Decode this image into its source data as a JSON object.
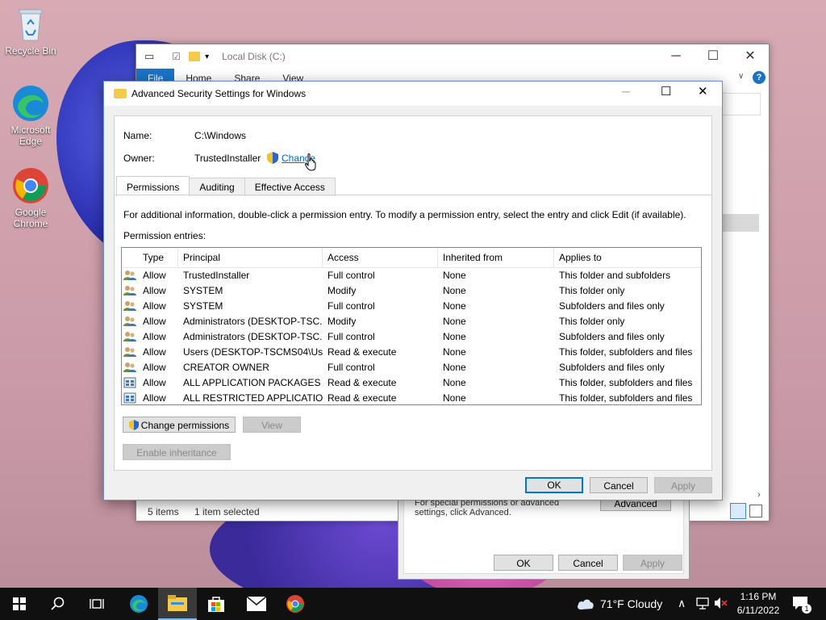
{
  "desktop": {
    "icons": [
      {
        "label": "Recycle Bin"
      },
      {
        "label": "Microsoft Edge"
      },
      {
        "label": "Google Chrome"
      }
    ]
  },
  "explorer": {
    "title": "Local Disk (C:)",
    "ribbon_tabs": [
      "File",
      "Home",
      "Share",
      "View"
    ],
    "status_items": "5 items",
    "status_selected": "1 item selected"
  },
  "properties_dialog": {
    "text": "For special permissions or advanced settings, click Advanced.",
    "advanced_label": "Advanced",
    "ok_label": "OK",
    "cancel_label": "Cancel",
    "apply_label": "Apply"
  },
  "dialog": {
    "title": "Advanced Security Settings for Windows",
    "name_label": "Name:",
    "name_value": "C:\\Windows",
    "owner_label": "Owner:",
    "owner_value": "TrustedInstaller",
    "change_link": "Change",
    "tabs": [
      "Permissions",
      "Auditing",
      "Effective Access"
    ],
    "info_text": "For additional information, double-click a permission entry. To modify a permission entry, select the entry and click Edit (if available).",
    "entries_label": "Permission entries:",
    "columns": [
      "Type",
      "Principal",
      "Access",
      "Inherited from",
      "Applies to"
    ],
    "rows": [
      {
        "type": "Allow",
        "principal": "TrustedInstaller",
        "access": "Full control",
        "inherited": "None",
        "applies": "This folder and subfolders",
        "icon": "user-group-icon"
      },
      {
        "type": "Allow",
        "principal": "SYSTEM",
        "access": "Modify",
        "inherited": "None",
        "applies": "This folder only",
        "icon": "user-group-icon"
      },
      {
        "type": "Allow",
        "principal": "SYSTEM",
        "access": "Full control",
        "inherited": "None",
        "applies": "Subfolders and files only",
        "icon": "user-group-icon"
      },
      {
        "type": "Allow",
        "principal": "Administrators (DESKTOP-TSC...",
        "access": "Modify",
        "inherited": "None",
        "applies": "This folder only",
        "icon": "user-group-icon"
      },
      {
        "type": "Allow",
        "principal": "Administrators (DESKTOP-TSC...",
        "access": "Full control",
        "inherited": "None",
        "applies": "Subfolders and files only",
        "icon": "user-group-icon"
      },
      {
        "type": "Allow",
        "principal": "Users (DESKTOP-TSCMS04\\Us...",
        "access": "Read & execute",
        "inherited": "None",
        "applies": "This folder, subfolders and files",
        "icon": "user-group-icon"
      },
      {
        "type": "Allow",
        "principal": "CREATOR OWNER",
        "access": "Full control",
        "inherited": "None",
        "applies": "Subfolders and files only",
        "icon": "user-group-icon"
      },
      {
        "type": "Allow",
        "principal": "ALL APPLICATION PACKAGES",
        "access": "Read & execute",
        "inherited": "None",
        "applies": "This folder, subfolders and files",
        "icon": "package-icon"
      },
      {
        "type": "Allow",
        "principal": "ALL RESTRICTED APPLICATIO...",
        "access": "Read & execute",
        "inherited": "None",
        "applies": "This folder, subfolders and files",
        "icon": "package-icon"
      }
    ],
    "change_permissions_label": "Change permissions",
    "view_label": "View",
    "enable_inheritance_label": "Enable inheritance",
    "ok_label": "OK",
    "cancel_label": "Cancel",
    "apply_label": "Apply"
  },
  "taskbar": {
    "weather": "71°F  Cloudy",
    "time": "1:16 PM",
    "date": "6/11/2022",
    "notification_count": "1"
  },
  "colors": {
    "accent": "#0078d7",
    "taskbar": "#101010"
  }
}
